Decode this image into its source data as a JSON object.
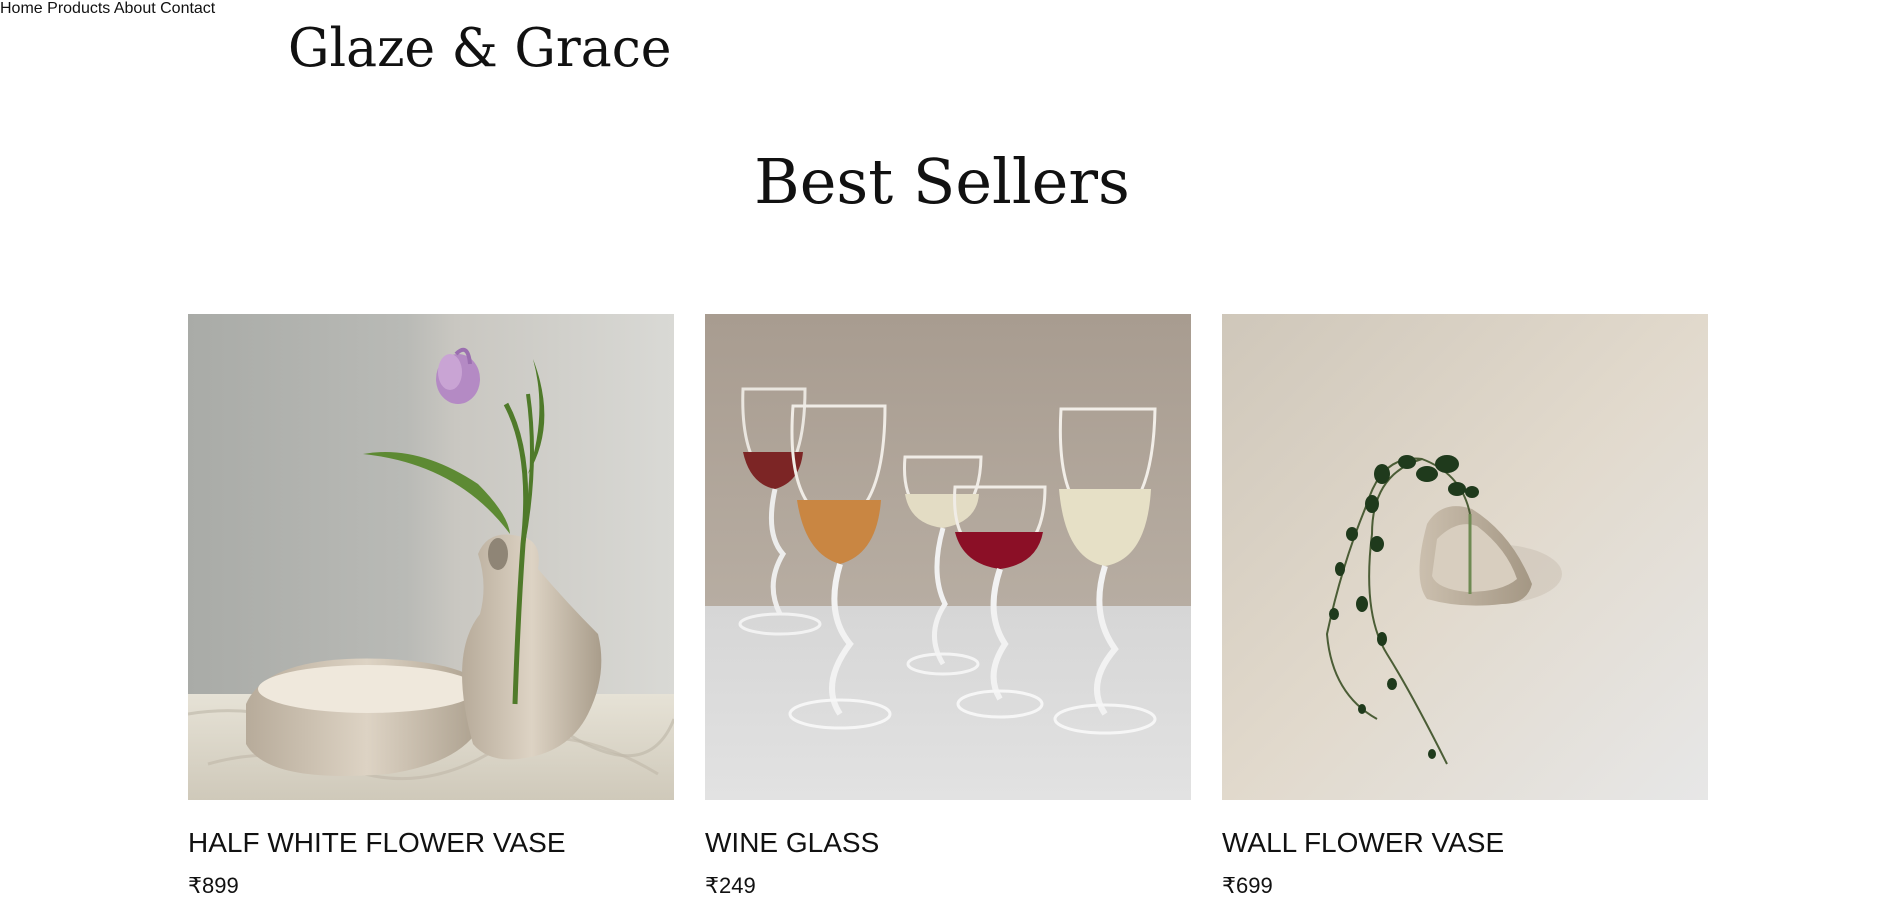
{
  "header": {
    "brand": "Glaze & Grace",
    "nav": [
      {
        "label": "Home"
      },
      {
        "label": "Products"
      },
      {
        "label": "About"
      },
      {
        "label": "Contact"
      }
    ]
  },
  "main": {
    "section_title": "Best Sellers",
    "products": [
      {
        "name": "HALF WHITE FLOWER VASE",
        "price": "₹899",
        "image": "half-white-flower-vase-photo"
      },
      {
        "name": "WINE GLASS",
        "price": "₹249",
        "image": "wine-glass-photo"
      },
      {
        "name": "WALL FLOWER VASE",
        "price": "₹699",
        "image": "wall-flower-vase-photo"
      }
    ]
  }
}
